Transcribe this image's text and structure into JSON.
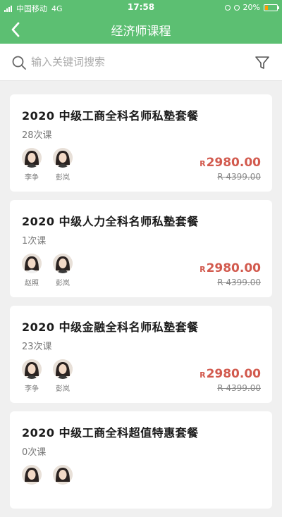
{
  "status_bar": {
    "carrier": "中国移动",
    "network": "4G",
    "time": "17:58",
    "battery": "20%",
    "battery_color": "#ff9b00"
  },
  "header": {
    "title": "经济师课程",
    "back_icon": "chevron-left-icon",
    "bg_color": "#5cbf72"
  },
  "search": {
    "placeholder": "输入关键词搜索",
    "value": "",
    "search_icon": "search-icon",
    "filter_icon": "filter-icon"
  },
  "courses": [
    {
      "title": "2020 中级工商全科名师私塾套餐",
      "count": "28次课",
      "teachers": [
        {
          "name": "李争"
        },
        {
          "name": "彭岚"
        }
      ],
      "currency": "R",
      "price": "2980.00",
      "original_price": "R 4399.00"
    },
    {
      "title": "2020 中级人力全科名师私塾套餐",
      "count": "1次课",
      "teachers": [
        {
          "name": "赵照"
        },
        {
          "name": "彭岚"
        }
      ],
      "currency": "R",
      "price": "2980.00",
      "original_price": "R 4399.00"
    },
    {
      "title": "2020 中级金融全科名师私塾套餐",
      "count": "23次课",
      "teachers": [
        {
          "name": "李争"
        },
        {
          "name": "彭岚"
        }
      ],
      "currency": "R",
      "price": "2980.00",
      "original_price": "R 4399.00"
    },
    {
      "title": "2020 中级工商全科超值特惠套餐",
      "count": "0次课",
      "teachers": [
        {
          "name": ""
        },
        {
          "name": ""
        }
      ],
      "currency": "",
      "price": "",
      "original_price": ""
    }
  ],
  "colors": {
    "price": "#d25a4e",
    "background": "#f0f0f0"
  }
}
